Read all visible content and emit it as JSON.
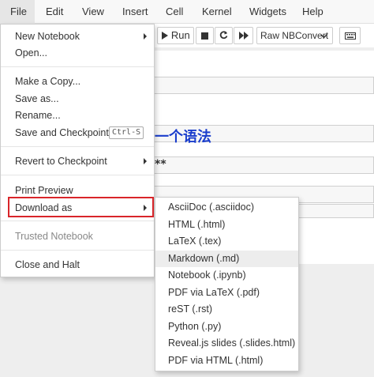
{
  "menubar": {
    "items": [
      "File",
      "Edit",
      "View",
      "Insert",
      "Cell",
      "Kernel",
      "Widgets",
      "Help"
    ]
  },
  "toolbar": {
    "run_label": "Run",
    "cell_type": "Raw NBConvert"
  },
  "notebook": {
    "heading_text": "一个语法",
    "bold_text": "**"
  },
  "file_menu": {
    "items": [
      {
        "label": "New Notebook",
        "submenu": true
      },
      {
        "label": "Open..."
      },
      {
        "label": "Make a Copy..."
      },
      {
        "label": "Save as..."
      },
      {
        "label": "Rename..."
      },
      {
        "label": "Save and Checkpoint",
        "shortcut": "Ctrl-S"
      },
      {
        "label": "Revert to Checkpoint",
        "submenu": true
      },
      {
        "label": "Print Preview"
      },
      {
        "label": "Download as",
        "submenu": true,
        "highlighted": true
      },
      {
        "label": "Trusted Notebook",
        "disabled": true
      },
      {
        "label": "Close and Halt"
      }
    ]
  },
  "download_menu": {
    "items": [
      "AsciiDoc (.asciidoc)",
      "HTML (.html)",
      "LaTeX (.tex)",
      "Markdown (.md)",
      "Notebook (.ipynb)",
      "PDF via LaTeX (.pdf)",
      "reST (.rst)",
      "Python (.py)",
      "Reveal.js slides (.slides.html)",
      "PDF via HTML (.html)"
    ],
    "hovered": "Markdown (.md)"
  },
  "colors": {
    "highlight_border": "#d9252a",
    "heading": "#1a3dcc"
  },
  "icons": [
    "play-icon",
    "stop-icon",
    "restart-icon",
    "fast-forward-icon",
    "keyboard-icon",
    "chevron-right-icon"
  ]
}
